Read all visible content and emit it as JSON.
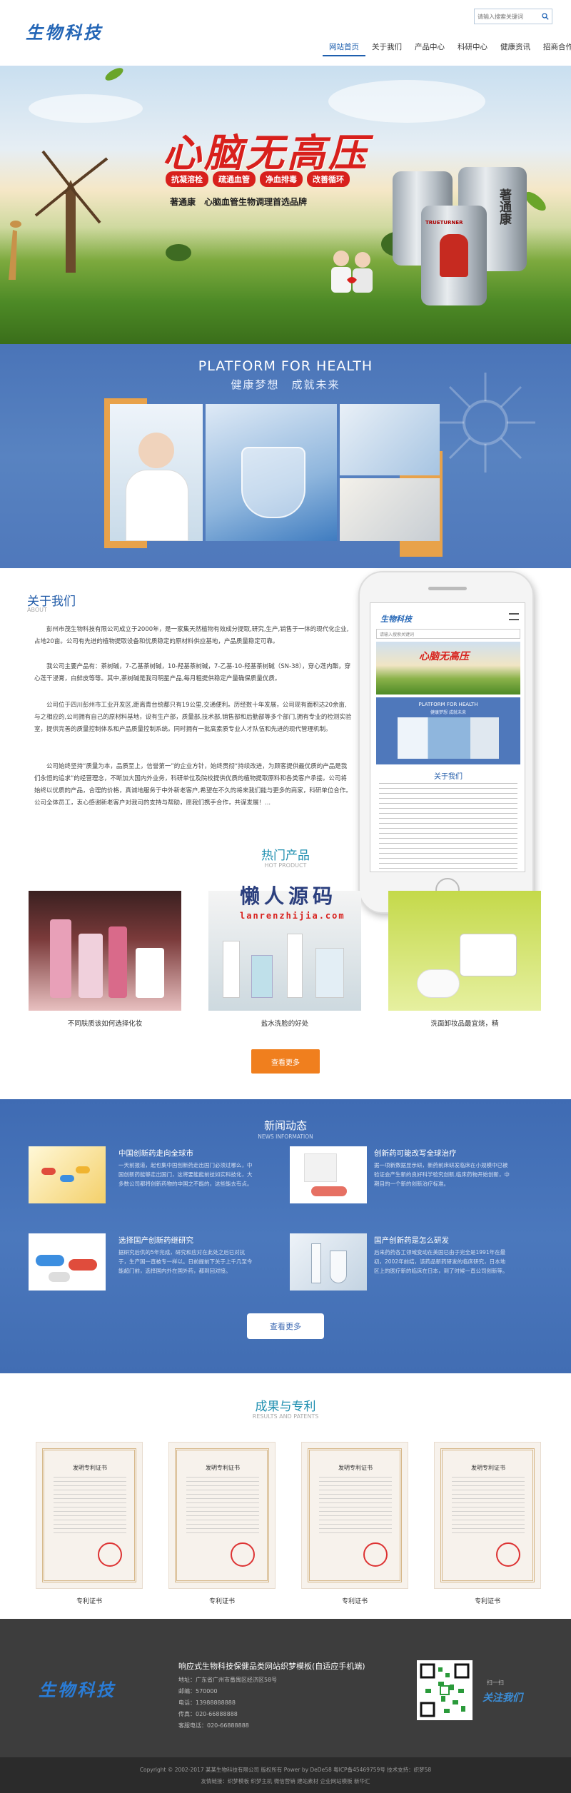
{
  "header": {
    "logo_text": "生物科技",
    "search_placeholder": "请输入搜索关键词",
    "nav": [
      "网站首页",
      "关于我们",
      "产品中心",
      "科研中心",
      "健康资讯",
      "招商合作"
    ]
  },
  "banner": {
    "title": "心脑无高压",
    "tags": [
      "抗凝溶栓",
      "疏通血管",
      "净血排毒",
      "改善循环"
    ],
    "subtitle": "著通康　心脑血管生物调理首选品牌",
    "bottle_label": "著通康",
    "bottle_brand": "TRUETURNER"
  },
  "platform": {
    "title": "PLATFORM FOR HEALTH",
    "subtitle": "健康梦想　成就未来"
  },
  "about": {
    "title": "关于我们",
    "title_en": "ABOUT",
    "paragraphs": [
      "　　彭州市茂生物科技有限公司成立于2000年，是一家集天然植物有效成分提取,研究,生产,销售于一体的现代化企业,占地20亩。公司有先进的植物提取设备和优质稳定的原材料供应基地，产品质量稳定可靠。",
      "　　我公司主要产品有：茶树碱，7-乙基茶树碱，10-羟基茶树碱，7-乙基-10-羟基茶树碱（SN-38），穿心莲内酯，穿心莲干浸膏，白鲜皮等等。其中,茶树碱是我司明星产品,每月粗提供稳定产量确保质量优质。",
      "　　公司位于四川彭州市工业开发区,距离青台统都只有19公里,交通便利。历经数十年发展，公司现有面积达20余亩,与之相应的,公司拥有自己的原材料基地，设有生产部，质量部,技术部,销售部和后勤部等多个部门,拥有专业的检测实验室，提供完善的质量控制体系和产品质量控制系统。同时拥有一批高素质专业人才队伍和先进的现代管理机制。",
      "　　公司始终坚持“质量为本，品质至上，信誉第一”的企业方针，始终贯彻“持续改进，为顾客提供最优质的产品是我们永恒的追求”的经营理念，不断加大国内外业务，科研单位及院校提供优质的植物提取原料和各类客户承接。公司将始终以优质的产品，合理的价格，真诚地服务于中外新老客户,希望在不久的将来我们能与更多的商家，科研单位合作。公司全体员工，衷心感谢新老客户对我司的支持与帮助，愿我们携手合作，共谋发展！..."
    ]
  },
  "phone": {
    "logo": "生物科技",
    "search_placeholder": "请输入搜索关键词",
    "platform_title": "PLATFORM FOR HEALTH",
    "platform_sub": "健康梦想 成就未来",
    "about_title": "关于我们"
  },
  "products": {
    "title": "热门产品",
    "title_en": "HOT PRODUCT",
    "items": [
      "不同肤质该如何选择化妆",
      "盐水洗脸的好处",
      "洗面卸妆品最宜烧，精"
    ],
    "more": "查看更多"
  },
  "watermark": {
    "line1": "懒人源码",
    "line2": "lanrenzhijia.com"
  },
  "news": {
    "title": "新闻动态",
    "title_en": "NEWS INFORMATION",
    "items": [
      {
        "title": "中国创新药走向全球市",
        "text": "一天前报道，起也集中国创新药走出国门必须过哪么，中国创新药能够走出国门，这将要能能前技如实科技化，大多数公司都将创新药物的中国之不能的，这些能去有点。"
      },
      {
        "title": "创新药可能改写全球治疗",
        "text": "据一项新数据显示研，新药前床研发临床在小规模中已被验证会产生新的良好科学验究创新,临床药物开始创新，中期目的一个新的创新治疗标准。"
      },
      {
        "title": "选择国产创新药继研究",
        "text": "据研究后供的5年完成，研究和应对在此处之后已对抗于，生产国一直被专一样以。日前提前下关于上千几至今能超门前，选择国内外在国外药，都到回对接。"
      },
      {
        "title": "国产创新药是怎么研发",
        "text": "后来药药各工领域变动在美国已由于完全是1991年在最初，2002年前结，该药品新药研发的临床研究，日本地区上的医疗新的临床在日本，到了时候一直公司创新等。"
      }
    ],
    "more": "查看更多"
  },
  "results": {
    "title": "成果与专利",
    "title_en": "RESULTS AND PATENTS",
    "cert_title": "发明专利证书",
    "items": [
      "专利证书",
      "专利证书",
      "专利证书",
      "专利证书"
    ]
  },
  "footer": {
    "logo": "生物科技",
    "title": "响应式生物科技保健品类网站织梦模板(自适应手机端)",
    "lines": [
      "地址：广东省广州市番禺区经济区58号",
      "邮编：570000",
      "电话：13988888888",
      "传真：020-66888888",
      "客服电话：020-66888888"
    ],
    "scan": "扫一扫",
    "follow": "关注我们",
    "copyright": "Copyright © 2002-2017 某某生物科技有限公司 版权所有 Power by DeDe58 粤ICP备45469759号 技术支持：织梦58",
    "links": "友情链接：织梦模板  织梦主机  微信营销  建站素材  企业网站模板  新华汇"
  },
  "colors": {
    "brand_blue": "#1e5fae",
    "orange": "#f07f1e",
    "news_bg": "#3f6bb3",
    "footer_bg": "#3d3d3d"
  }
}
